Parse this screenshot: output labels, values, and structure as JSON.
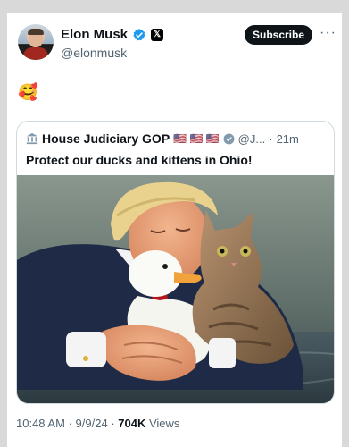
{
  "post": {
    "author_name": "Elon Musk",
    "author_handle": "@elonmusk",
    "subscribe_label": "Subscribe",
    "more_label": "···",
    "body_emoji": "🥰",
    "icons": {
      "verified": "verified-badge-icon",
      "affiliate": "x-logo-icon",
      "more": "more-dots-icon"
    }
  },
  "quoted": {
    "author_name": "House Judiciary GOP",
    "flags": "🇺🇸 🇺🇸 🇺🇸",
    "handle_trunc": "@J...",
    "separator": "·",
    "time": "21m",
    "text": "Protect our ducks and kittens in Ohio!",
    "image_alt": "man hugging a white duck and a tabby kitten on water"
  },
  "footer": {
    "time": "10:48 AM",
    "sep1": "·",
    "date": "9/9/24",
    "sep2": "·",
    "views_count": "704K",
    "views_label": "Views"
  },
  "colors": {
    "accent_blue": "#1d9bf0",
    "text": "#0f1419",
    "muted": "#536471",
    "border": "#cfd9de",
    "gov_gray": "#829aab"
  }
}
